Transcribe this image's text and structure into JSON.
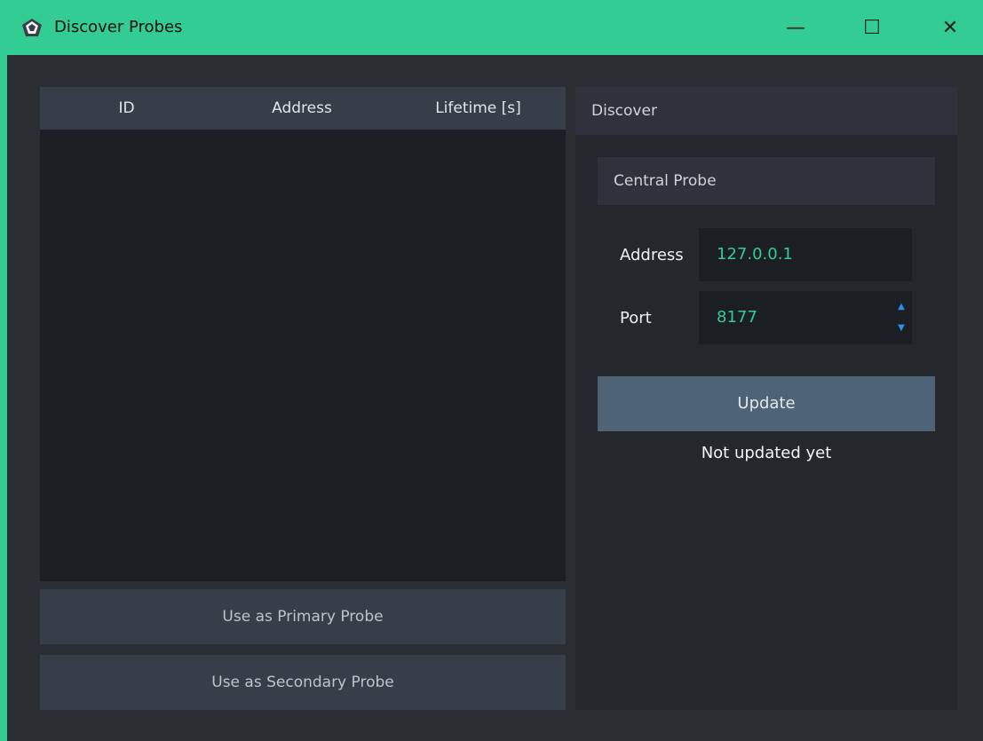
{
  "window": {
    "title": "Discover Probes",
    "controls": {
      "minimize": "—",
      "maximize": "☐",
      "close": "✕"
    }
  },
  "table": {
    "columns": [
      "ID",
      "Address",
      "Lifetime [s]"
    ],
    "rows": []
  },
  "buttons": {
    "primary": "Use as Primary Probe",
    "secondary": "Use as Secondary Probe"
  },
  "discover": {
    "title": "Discover",
    "central_probe": {
      "title": "Central Probe",
      "address_label": "Address",
      "address_value": "127.0.0.1",
      "port_label": "Port",
      "port_value": "8177"
    },
    "update_label": "Update",
    "status": "Not updated yet"
  },
  "colors": {
    "accent": "#33cc92",
    "spinner": "#2e8ef0"
  }
}
